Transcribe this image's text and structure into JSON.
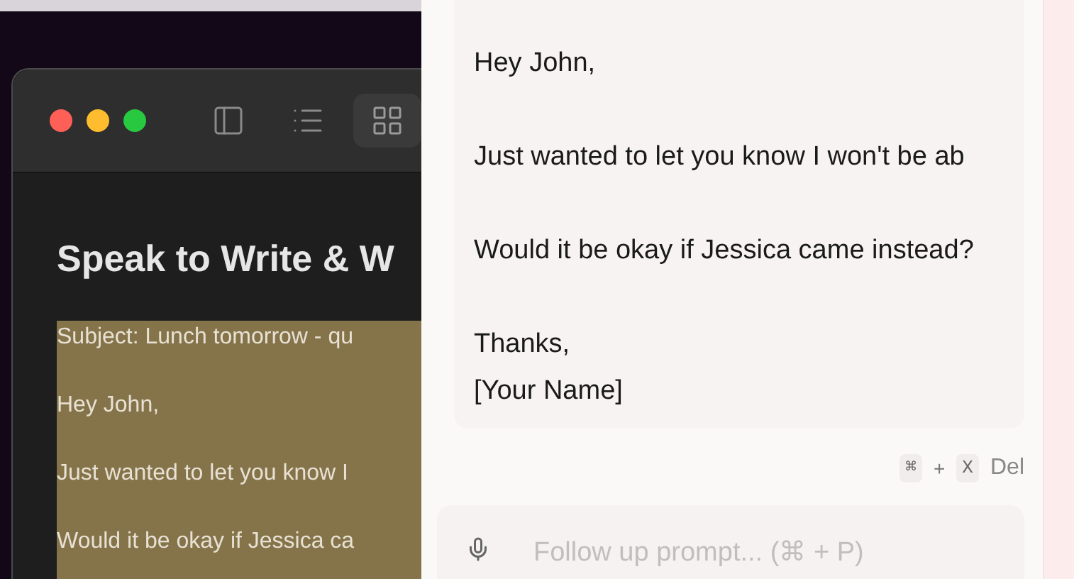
{
  "editor_window": {
    "toolbar": [
      {
        "kind": "sidebar",
        "selected": false
      },
      {
        "kind": "list",
        "selected": false
      },
      {
        "kind": "grid",
        "selected": true
      }
    ],
    "title": "Speak to Write & W",
    "selected_lines": [
      "Subject: Lunch tomorrow - qu",
      "Hey John,",
      "Just wanted to let you know I",
      "Would it be okay if Jessica ca"
    ]
  },
  "response_panel": {
    "paragraphs": [
      [
        "Hey John,"
      ],
      [
        "Just wanted to let you know I won't be ab"
      ],
      [
        "Would it be okay if Jessica came instead?"
      ],
      [
        "Thanks,",
        "[Your Name]"
      ]
    ],
    "shortcut": {
      "keys": [
        "⌘",
        "X"
      ],
      "separator": "+",
      "label": "Del"
    },
    "prompt": {
      "placeholder": "Follow up prompt... (⌘ + P)"
    }
  }
}
